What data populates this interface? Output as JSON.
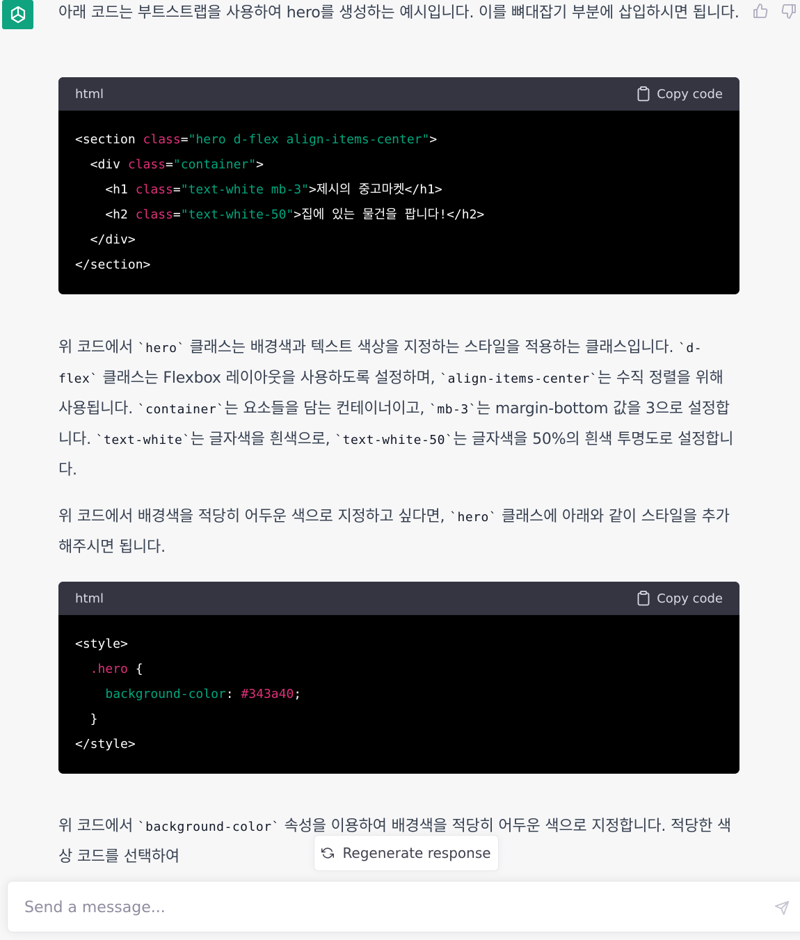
{
  "message": {
    "intro": "아래 코드는 부트스트랩을 사용하여 hero를 생성하는 예시입니다. 이를 뼈대잡기 부분에 삽입하시면 됩니다.",
    "para1": [
      "위 코드에서 ",
      "`hero`",
      " 클래스는 배경색과 텍스트 색상을 지정하는 스타일을 적용하는 클래스입니다. ",
      "`d-flex`",
      " 클래스는 Flexbox 레이아웃을 사용하도록 설정하며, ",
      "`align-items-center`",
      "는 수직 정렬을 위해 사용됩니다. ",
      "`container`",
      "는 요소들을 담는 컨테이너이고, ",
      "`mb-3`",
      "는 margin-bottom 값을 3으로 설정합니다. ",
      "`text-white`",
      "는 글자색을 흰색으로, ",
      "`text-white-50`",
      "는 글자색을 50%의 흰색 투명도로 설정합니다."
    ],
    "para2": [
      "위 코드에서 배경색을 적당히 어두운 색으로 지정하고 싶다면, ",
      "`hero`",
      " 클래스에 아래와 같이 스타일을 추가해주시면 됩니다."
    ],
    "para3": [
      "위 코드에서 ",
      "`background-color`",
      " 속성을 이용하여 배경색을 적당히 어두운 색으로 지정합니다. 적당한 색상 코드를 선택하여"
    ]
  },
  "code1": {
    "lang": "html",
    "copy_label": "Copy code",
    "lines": {
      "l1": {
        "a": "<section ",
        "b": "class",
        "c": "=",
        "d": "\"hero d-flex align-items-center\"",
        "e": ">"
      },
      "l2": {
        "a": "  <div ",
        "b": "class",
        "c": "=",
        "d": "\"container\"",
        "e": ">"
      },
      "l3": {
        "a": "    <h1 ",
        "b": "class",
        "c": "=",
        "d": "\"text-white mb-3\"",
        "e": ">제시의 중고마켓</h1>"
      },
      "l4": {
        "a": "    <h2 ",
        "b": "class",
        "c": "=",
        "d": "\"text-white-50\"",
        "e": ">집에 있는 물건을 팝니다!</h2>"
      },
      "l5": "  </div>",
      "l6": "</section>"
    }
  },
  "code2": {
    "lang": "html",
    "copy_label": "Copy code",
    "lines": {
      "l1": "<style>",
      "l2": {
        "indent": "  ",
        "sel": ".hero",
        "rest": " {"
      },
      "l3": {
        "indent": "    ",
        "prop": "background-color",
        "colon": ": ",
        "val": "#343a40",
        "end": ";"
      },
      "l4": "  }",
      "l5": "</style>"
    }
  },
  "regenerate_label": "Regenerate response",
  "input": {
    "placeholder": "Send a message..."
  },
  "colors": {
    "brand": "#10a37f",
    "code_bg": "#000000",
    "code_header": "#343541"
  },
  "icons": [
    "openai-logo-icon",
    "thumbs-up-icon",
    "thumbs-down-icon",
    "clipboard-icon",
    "refresh-icon",
    "send-icon"
  ]
}
